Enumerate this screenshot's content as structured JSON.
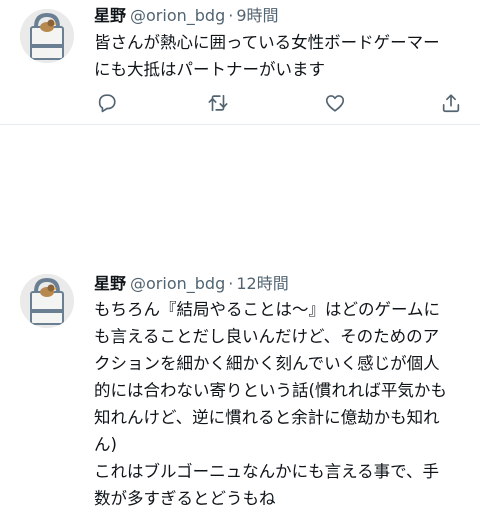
{
  "tweets": [
    {
      "name": "星野",
      "handle": "@orion_bdg",
      "separator": "·",
      "time": "9時間",
      "text": "皆さんが熱心に囲っている女性ボードゲーマー\nにも大抵はパートナーがいます",
      "actions": {
        "reply_icon": "reply-icon",
        "retweet_icon": "retweet-icon",
        "like_icon": "heart-icon",
        "share_icon": "share-icon"
      }
    },
    {
      "name": "星野",
      "handle": "@orion_bdg",
      "separator": "·",
      "time": "12時間",
      "text": "もちろん『結局やることは〜』はどのゲームに\nも言えることだし良いんだけど、そのためのア\nクションを細かく細かく刻んでいく感じが個人\n的には合わない寄りという話(慣れれば平気かも\n知れんけど、逆に慣れると余計に億劫かも知れ\nん)\nこれはブルゴーニュなんかにも言える事で、手\n数が多すぎるとどうもね"
    }
  ],
  "colors": {
    "text": "#0f1419",
    "secondary": "#536471",
    "divider": "#e6ecf0",
    "avatar_bg": "#eaeaea"
  }
}
